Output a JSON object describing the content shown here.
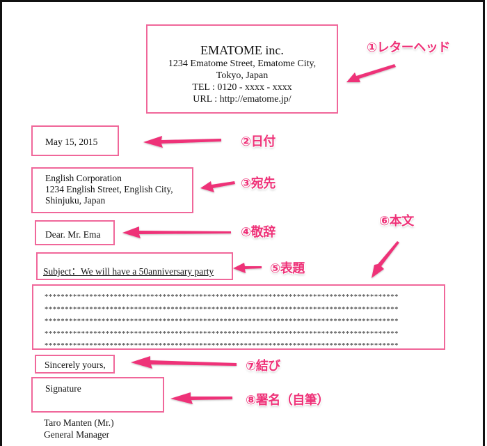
{
  "letter": {
    "letterhead": {
      "company": "EMATOME inc.",
      "address_line1": "1234 Ematome Street, Ematome City,",
      "address_line2": "Tokyo, Japan",
      "tel": "TEL : 0120 - xxxx - xxxx",
      "url": "URL : http://ematome.jp/"
    },
    "date": "May 15, 2015",
    "recipient": {
      "line1": "English Corporation",
      "line2": "1234 English Street, English City,",
      "line3": "Shinjuku, Japan"
    },
    "salutation": "Dear. Mr. Ema",
    "subject": "Subject：We will have a 50anniversary party",
    "body_lines": [
      "***************************************************************************************",
      "***************************************************************************************",
      "***************************************************************************************",
      "***************************************************************************************",
      "***************************************************************************************"
    ],
    "closing": "Sincerely yours,",
    "signature": "Signature",
    "signer": {
      "name": "Taro Manten (Mr.)",
      "title": "General Manager"
    }
  },
  "annotations": {
    "color": "#ee3278",
    "box_color": "#f0679a",
    "items": [
      {
        "label": "①レターヘッド",
        "target": "letterhead"
      },
      {
        "label": "②日付",
        "target": "date"
      },
      {
        "label": "③宛先",
        "target": "recipient"
      },
      {
        "label": "④敬辞",
        "target": "salutation"
      },
      {
        "label": "⑤表題",
        "target": "subject"
      },
      {
        "label": "⑥本文",
        "target": "body"
      },
      {
        "label": "⑦結び",
        "target": "closing"
      },
      {
        "label": "⑧署名（自筆）",
        "target": "signature"
      }
    ]
  }
}
